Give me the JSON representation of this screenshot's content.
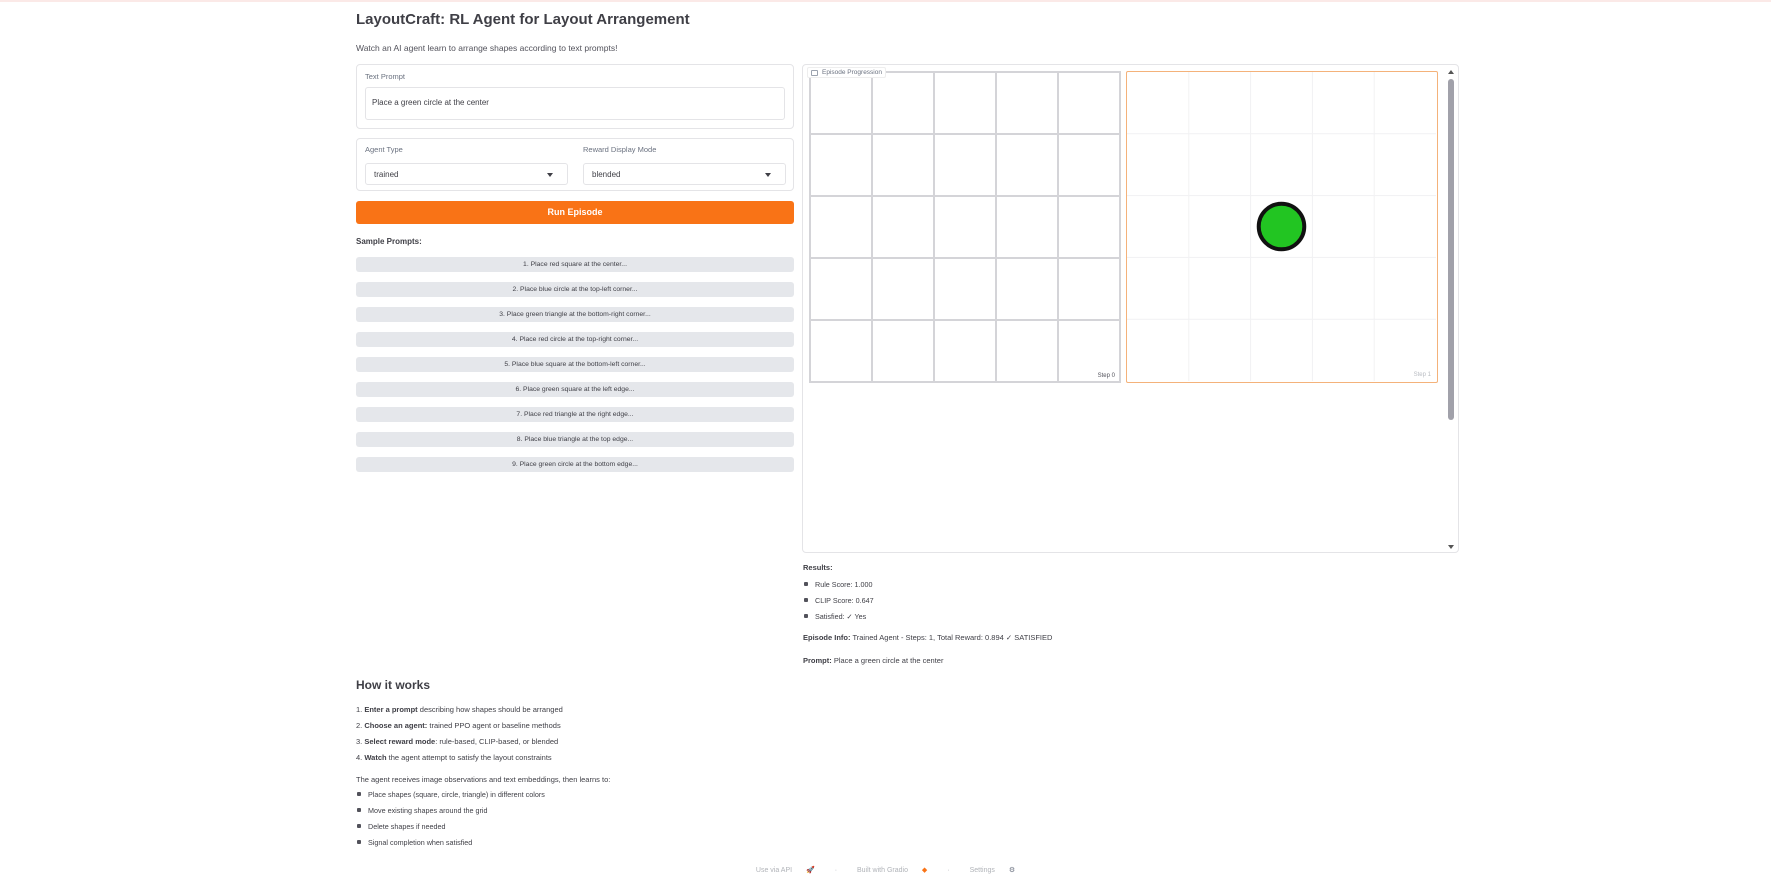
{
  "app": {
    "title": "LayoutCraft: RL Agent for Layout Arrangement",
    "subtitle": "Watch an AI agent learn to arrange shapes according to text prompts!"
  },
  "prompt_field": {
    "label": "Text Prompt",
    "value": "Place a green circle at the center"
  },
  "agent_type": {
    "label": "Agent Type",
    "value": "trained"
  },
  "reward_mode": {
    "label": "Reward Display Mode",
    "value": "blended"
  },
  "run_button": {
    "label": "Run Episode"
  },
  "samples": {
    "title": "Sample Prompts:",
    "items": [
      "1. Place red square at the center...",
      "2. Place blue circle at the top-left corner...",
      "3. Place green triangle at the bottom-right corner...",
      "4. Place red circle at the top-right corner...",
      "5. Place blue square at the bottom-left corner...",
      "6. Place green square at the left edge...",
      "7. Place red triangle at the right edge...",
      "8. Place blue triangle at the top edge...",
      "9. Place green circle at the bottom edge..."
    ]
  },
  "episode": {
    "label": "Episode Progression",
    "frames": [
      {
        "step_label": "Step 0"
      },
      {
        "step_label": "Step 1",
        "shape": "circle",
        "shape_color": "#22c522",
        "grid_col": 2,
        "grid_row": 2
      }
    ]
  },
  "results": {
    "title": "Results:",
    "items": [
      "Rule Score: 1.000",
      "CLIP Score: 0.647",
      "Satisfied: ✓ Yes"
    ],
    "episode_info_label": "Episode Info:",
    "episode_info_value": " Trained Agent - Steps: 1, Total Reward: 0.894 ✓ SATISFIED",
    "prompt_label": "Prompt:",
    "prompt_value": " Place a green circle at the center"
  },
  "how_it_works": {
    "title": "How it works",
    "steps": [
      {
        "num": "1. ",
        "bold": "Enter a prompt",
        "rest": " describing how shapes should be arranged"
      },
      {
        "num": "2. ",
        "bold": "Choose an agent:",
        "rest": " trained PPO agent or baseline methods"
      },
      {
        "num": "3. ",
        "bold": "Select reward mode",
        "rest": ": rule-based, CLIP-based, or blended"
      },
      {
        "num": "4. ",
        "bold": "Watch",
        "rest": " the agent attempt to satisfy the layout constraints"
      }
    ],
    "description": "The agent receives image observations and text embeddings, then learns to:",
    "bullets": [
      "Place shapes (square, circle, triangle) in different colors",
      "Move existing shapes around the grid",
      "Delete shapes if needed",
      "Signal completion when satisfied"
    ]
  },
  "footer": {
    "api": "Use via API",
    "api_icon": "rocket-icon",
    "built": "Built with Gradio",
    "built_icon": "gradio-logo-icon",
    "settings": "Settings",
    "settings_icon": "gear-icon"
  },
  "colors": {
    "accent": "#f97316",
    "shape_fill": "#22c522"
  }
}
